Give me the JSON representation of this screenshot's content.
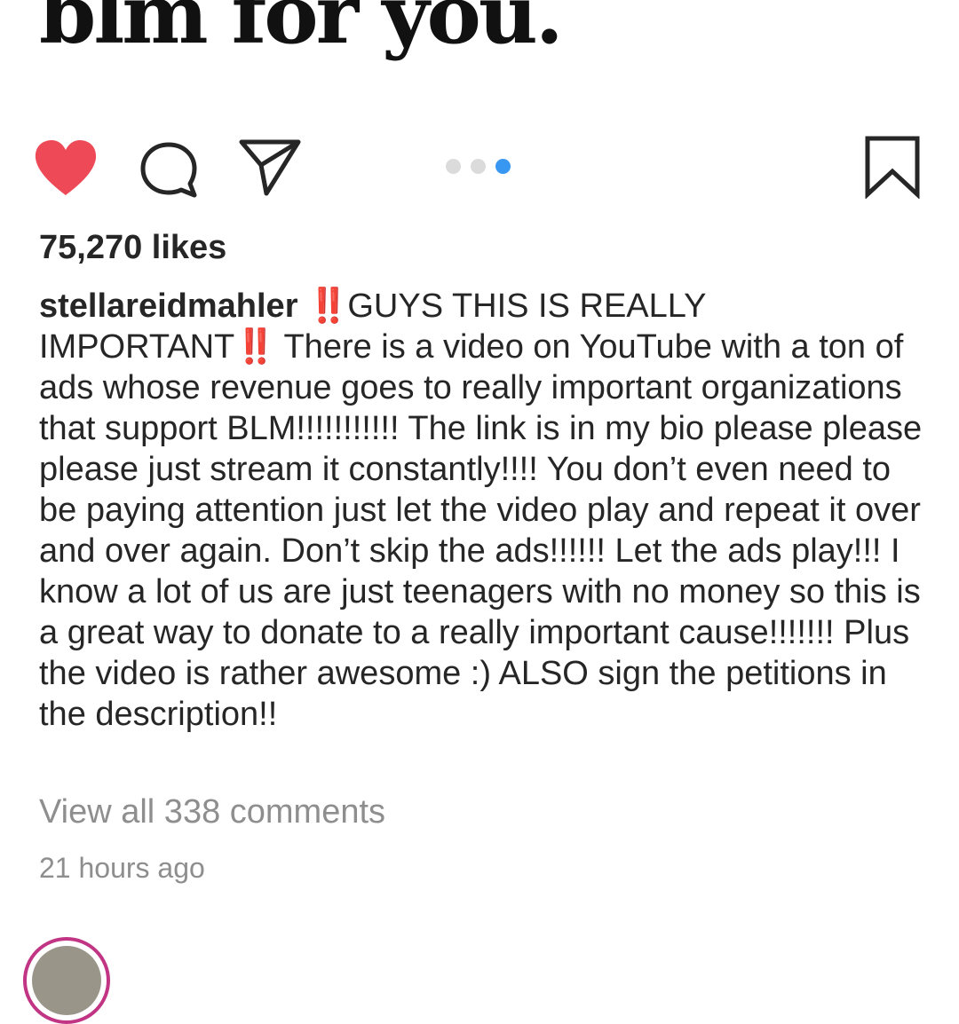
{
  "post": {
    "title": "blm for you.",
    "likes": "75,270 likes",
    "caption": {
      "username": "stellareidmahler",
      "emoji": "‼️",
      "part1": "GUYS THIS IS REALLY IMPORTANT",
      "part2": "There is a video on YouTube with a ton of ads whose revenue goes to really important organizations that support BLM!!!!!!!!!!! The link is in my bio please please please just stream it constantly!!!! You don’t even need to be paying attention just let the video play and repeat it over and over again. Don’t skip the ads!!!!!! Let the ads play!!! I know a lot of us are just teenagers with no money so this is a great way to donate to a really important cause!!!!!!! Plus the video is rather awesome :) ALSO sign the petitions in the description!!"
    },
    "view_comments": "View all 338 comments",
    "timestamp": "21 hours ago"
  },
  "actions": {
    "like_icon": "heart-filled-icon",
    "comment_icon": "comment-bubble-icon",
    "share_icon": "paper-plane-icon",
    "save_icon": "bookmark-icon",
    "like_color": "#ed4956"
  },
  "carousel": {
    "total": 3,
    "active_index": 3,
    "active_color": "#3897f0",
    "inactive_color": "#dbdbdb"
  }
}
